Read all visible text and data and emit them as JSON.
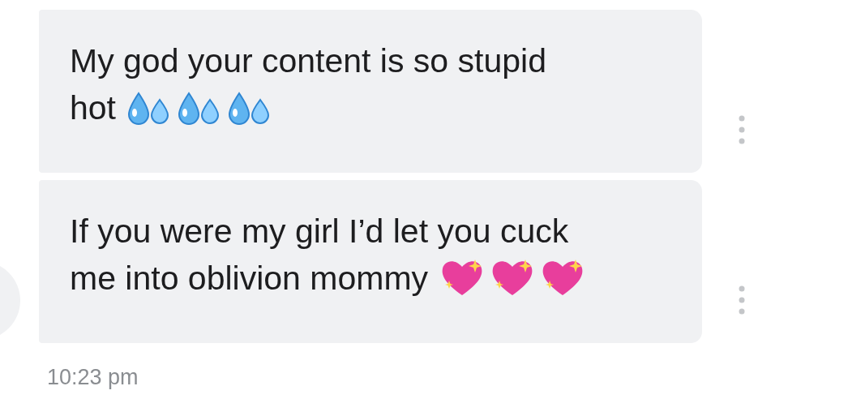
{
  "messages": [
    {
      "lines": [
        "My god your content is so stupid",
        "hot"
      ],
      "emojis": [
        {
          "kind": "droplets"
        },
        {
          "kind": "droplets"
        },
        {
          "kind": "droplets"
        }
      ],
      "avatar": false
    },
    {
      "lines": [
        "If you were my girl I’d let you cuck",
        "me into oblivion mommy"
      ],
      "emojis": [
        {
          "kind": "heart"
        },
        {
          "kind": "heart"
        },
        {
          "kind": "heart"
        }
      ],
      "avatar": true
    }
  ],
  "timestamp": "10:23 pm"
}
